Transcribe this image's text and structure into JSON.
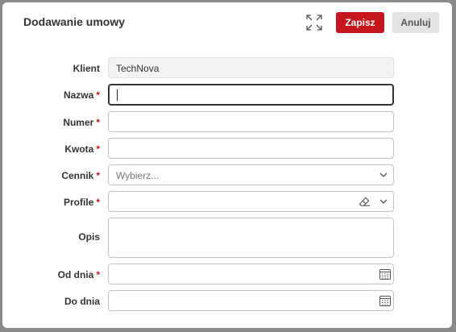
{
  "dialog": {
    "title": "Dodawanie umowy",
    "save_label": "Zapisz",
    "cancel_label": "Anuluj"
  },
  "fields": {
    "client": {
      "label": "Klient",
      "value": "TechNova"
    },
    "name": {
      "label": "Nazwa",
      "required": "*",
      "value": ""
    },
    "number": {
      "label": "Numer",
      "required": "*",
      "value": ""
    },
    "amount": {
      "label": "Kwota",
      "required": "*",
      "value": ""
    },
    "pricelist": {
      "label": "Cennik",
      "required": "*",
      "placeholder": "Wybierz..."
    },
    "profile": {
      "label": "Profile",
      "required": "*",
      "value": ""
    },
    "description": {
      "label": "Opis",
      "value": ""
    },
    "date_from": {
      "label": "Od dnia",
      "required": "*",
      "value": ""
    },
    "date_to": {
      "label": "Do dnia",
      "value": ""
    }
  },
  "icons": {
    "expand": "expand-icon",
    "chevron": "chevron-down-icon",
    "eraser": "eraser-icon",
    "calendar": "calendar-icon"
  },
  "colors": {
    "accent": "#c4161c",
    "required": "#c4161c",
    "cancel_bg": "#e4e4e4"
  }
}
